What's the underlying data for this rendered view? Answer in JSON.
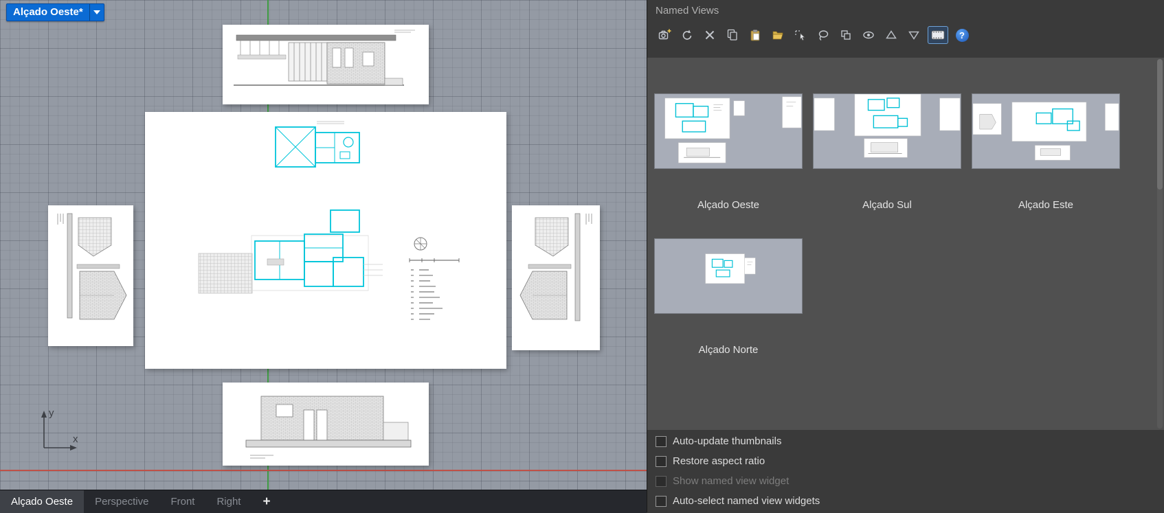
{
  "viewport": {
    "title": "Alçado Oeste*",
    "axis": {
      "x": "x",
      "y": "y"
    }
  },
  "tabbar": {
    "tabs": [
      {
        "label": "Alçado Oeste",
        "active": true
      },
      {
        "label": "Perspective",
        "active": false
      },
      {
        "label": "Front",
        "active": false
      },
      {
        "label": "Right",
        "active": false
      }
    ],
    "add_label": "+"
  },
  "panel": {
    "title": "Named Views",
    "toolbar_icons": [
      "save-named-view-icon",
      "restore-named-view-icon",
      "delete-named-view-icon",
      "copy-named-view-icon",
      "paste-named-view-icon",
      "import-named-views-icon",
      "pick-view-icon",
      "lasso-select-icon",
      "duplicate-view-icon",
      "show-view-icon",
      "move-up-icon",
      "move-down-icon",
      "thumbnail-display-toggle-icon",
      "help-icon"
    ],
    "views": [
      {
        "label": "Alçado Oeste"
      },
      {
        "label": "Alçado Sul"
      },
      {
        "label": "Alçado Este"
      },
      {
        "label": "Alçado Norte"
      }
    ],
    "options": [
      {
        "label": "Auto-update thumbnails",
        "checked": false,
        "enabled": true
      },
      {
        "label": "Restore aspect ratio",
        "checked": false,
        "enabled": true
      },
      {
        "label": "Show named view widget",
        "checked": false,
        "enabled": false
      },
      {
        "label": "Auto-select named view widgets",
        "checked": false,
        "enabled": true
      }
    ],
    "help_glyph": "?"
  },
  "colors": {
    "accent_blue": "#0b6bd4",
    "plan_cyan": "#00c5da",
    "viewport_bg": "#949aa4",
    "panel_bg": "#3a3a3a",
    "views_bg": "#505050",
    "axis_green": "#3f9b43",
    "axis_red": "#bf5148"
  }
}
